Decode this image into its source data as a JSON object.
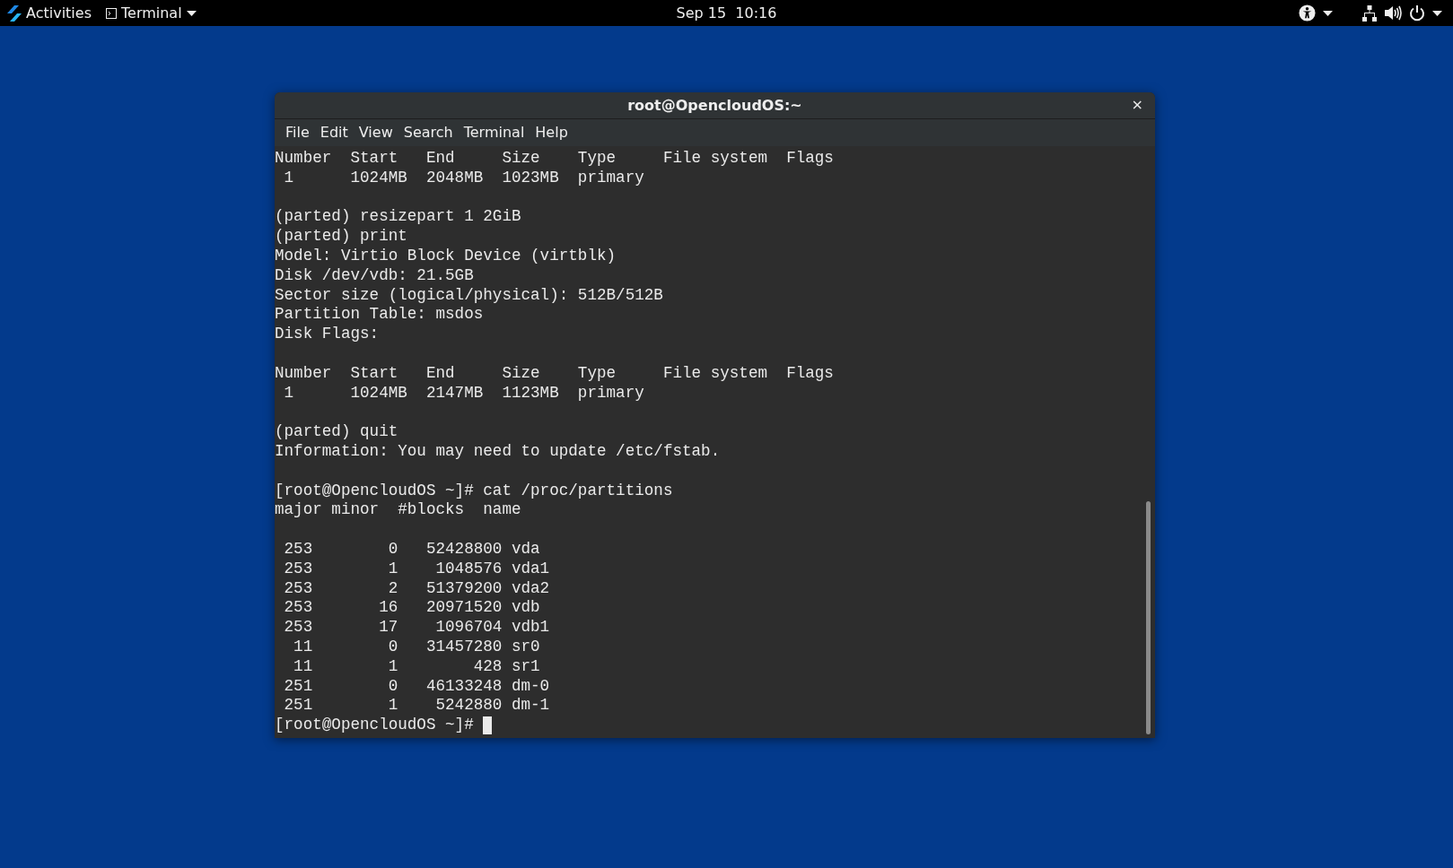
{
  "top_bar": {
    "activities": "Activities",
    "app_menu": "Terminal",
    "clock": "Sep 15  10:16"
  },
  "window": {
    "title": "root@OpencloudOS:~",
    "close": "×"
  },
  "menu": [
    "File",
    "Edit",
    "View",
    "Search",
    "Terminal",
    "Help"
  ],
  "output_blocks": [
    [
      "Number  Start   End     Size    Type     File system  Flags",
      " 1      1024MB  2048MB  1023MB  primary"
    ],
    [
      "(parted) resizepart 1 2GiB",
      "(parted) print",
      "Model: Virtio Block Device (virtblk)",
      "Disk /dev/vdb: 21.5GB",
      "Sector size (logical/physical): 512B/512B",
      "Partition Table: msdos",
      "Disk Flags:"
    ],
    [
      "Number  Start   End     Size    Type     File system  Flags",
      " 1      1024MB  2147MB  1123MB  primary"
    ],
    [
      "(parted) quit",
      "Information: You may need to update /etc/fstab."
    ],
    [
      "[root@OpencloudOS ~]# cat /proc/partitions",
      "major minor  #blocks  name"
    ],
    [
      " 253        0   52428800 vda",
      " 253        1    1048576 vda1",
      " 253        2   51379200 vda2",
      " 253       16   20971520 vdb",
      " 253       17    1096704 vdb1",
      "  11        0   31457280 sr0",
      "  11        1        428 sr1",
      " 251        0   46133248 dm-0",
      " 251        1    5242880 dm-1"
    ]
  ],
  "prompt": "[root@OpencloudOS ~]# "
}
